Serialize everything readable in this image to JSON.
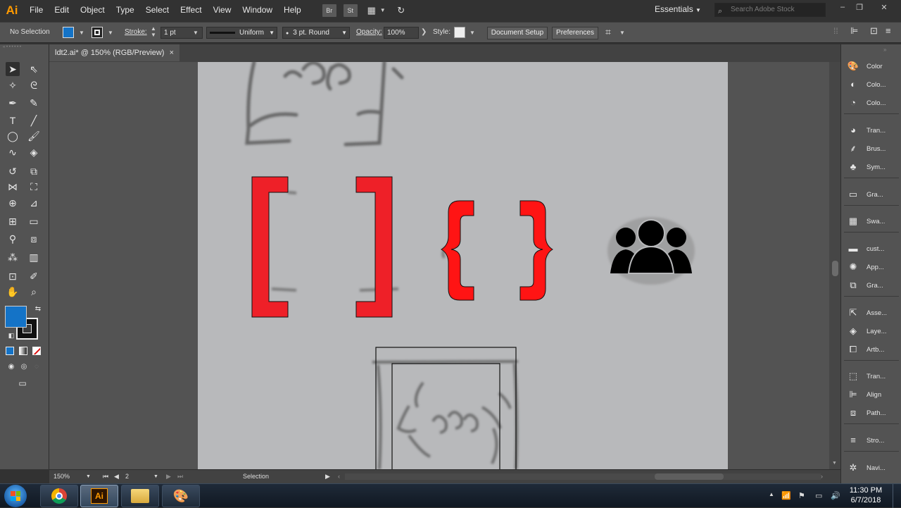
{
  "app": {
    "logo": "Ai",
    "menu": [
      "File",
      "Edit",
      "Object",
      "Type",
      "Select",
      "Effect",
      "View",
      "Window",
      "Help"
    ],
    "bridge_label": "Br",
    "stock_label": "St",
    "workspace": "Essentials",
    "stock_search_placeholder": "Search Adobe Stock"
  },
  "control": {
    "selection": "No Selection",
    "stroke_label": "Stroke:",
    "stroke_weight": "1 pt",
    "stroke_profile": "Uniform",
    "brush": "3 pt. Round",
    "opacity_label": "Opacity:",
    "opacity_value": "100%",
    "style_label": "Style:",
    "document_setup": "Document Setup",
    "preferences": "Preferences",
    "fill_color": "#1473c7"
  },
  "document": {
    "tab_title": "ldt2.ai* @ 150% (RGB/Preview)",
    "close_glyph": "×"
  },
  "status": {
    "zoom": "150%",
    "artboard_number": "2",
    "tool": "Selection"
  },
  "dock": {
    "items": [
      {
        "label": "Color",
        "icon": "color-icon"
      },
      {
        "label": "Colo...",
        "icon": "color-guide-icon"
      },
      {
        "label": "Colo...",
        "icon": "color-themes-icon"
      },
      {
        "label": "Tran...",
        "icon": "transparency-icon"
      },
      {
        "label": "Brus...",
        "icon": "brushes-icon"
      },
      {
        "label": "Sym...",
        "icon": "symbols-icon"
      },
      {
        "label": "Gra...",
        "icon": "gradient-icon"
      },
      {
        "label": "Swa...",
        "icon": "swatches-icon"
      },
      {
        "label": "cust...",
        "icon": "custom-library-icon"
      },
      {
        "label": "App...",
        "icon": "appearance-icon"
      },
      {
        "label": "Gra...",
        "icon": "graphic-styles-icon"
      },
      {
        "label": "Asse...",
        "icon": "asset-export-icon"
      },
      {
        "label": "Laye...",
        "icon": "layers-icon"
      },
      {
        "label": "Artb...",
        "icon": "artboards-icon"
      },
      {
        "label": "Tran...",
        "icon": "transform-icon"
      },
      {
        "label": "Align",
        "icon": "align-icon"
      },
      {
        "label": "Path...",
        "icon": "pathfinder-icon"
      },
      {
        "label": "Stro...",
        "icon": "stroke-icon"
      },
      {
        "label": "Navi...",
        "icon": "navigator-icon"
      }
    ]
  },
  "taskbar": {
    "time": "11:30 PM",
    "date": "6/7/2018"
  },
  "colors": {
    "bracket_red": "#ee2028",
    "brace_red": "#ff1414",
    "artboard_gray": "#b8b9bb",
    "ai_orange": "#ff9a00"
  }
}
